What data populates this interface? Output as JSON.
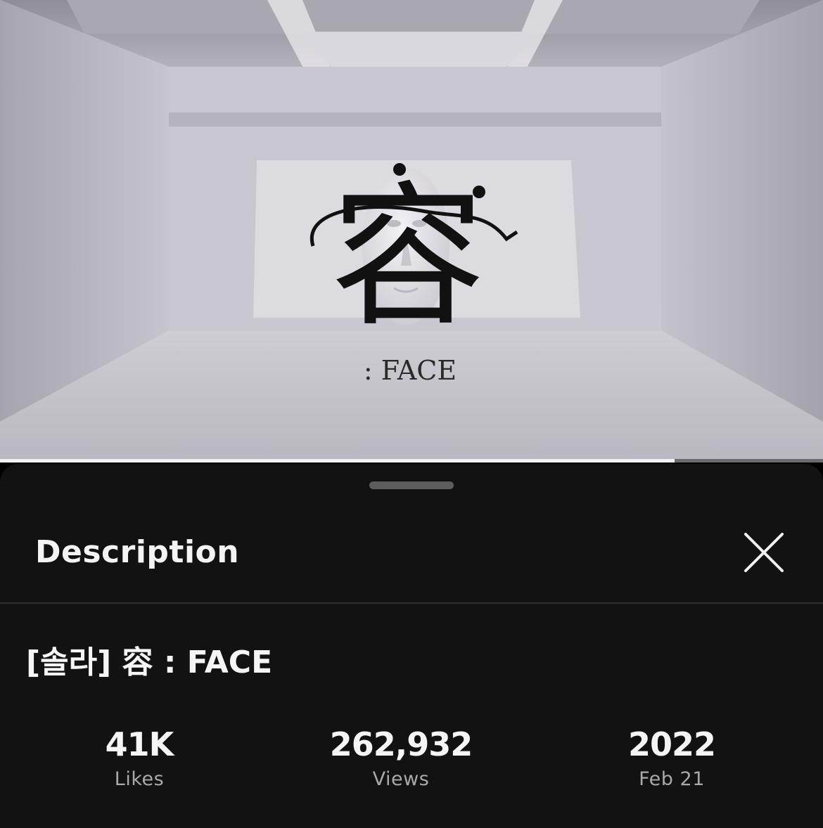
{
  "video": {
    "overlay_title": ": FACE",
    "overlay_glyph": "容",
    "playback_progress": 0.82
  },
  "sheet": {
    "title": "Description",
    "close_icon": "close-icon"
  },
  "details": {
    "title": "[솔라] 容 : FACE",
    "stats": {
      "likes_value": "41K",
      "likes_label": "Likes",
      "views_value": "262,932",
      "views_label": "Views",
      "year_value": "2022",
      "date_label": "Feb 21"
    }
  },
  "colors": {
    "sheet_background": "#121212",
    "text_primary": "#f5f5f5",
    "text_secondary": "#a9a9a9",
    "progress_fill": "#f2f2f2",
    "progress_track": "#6d6b70"
  }
}
